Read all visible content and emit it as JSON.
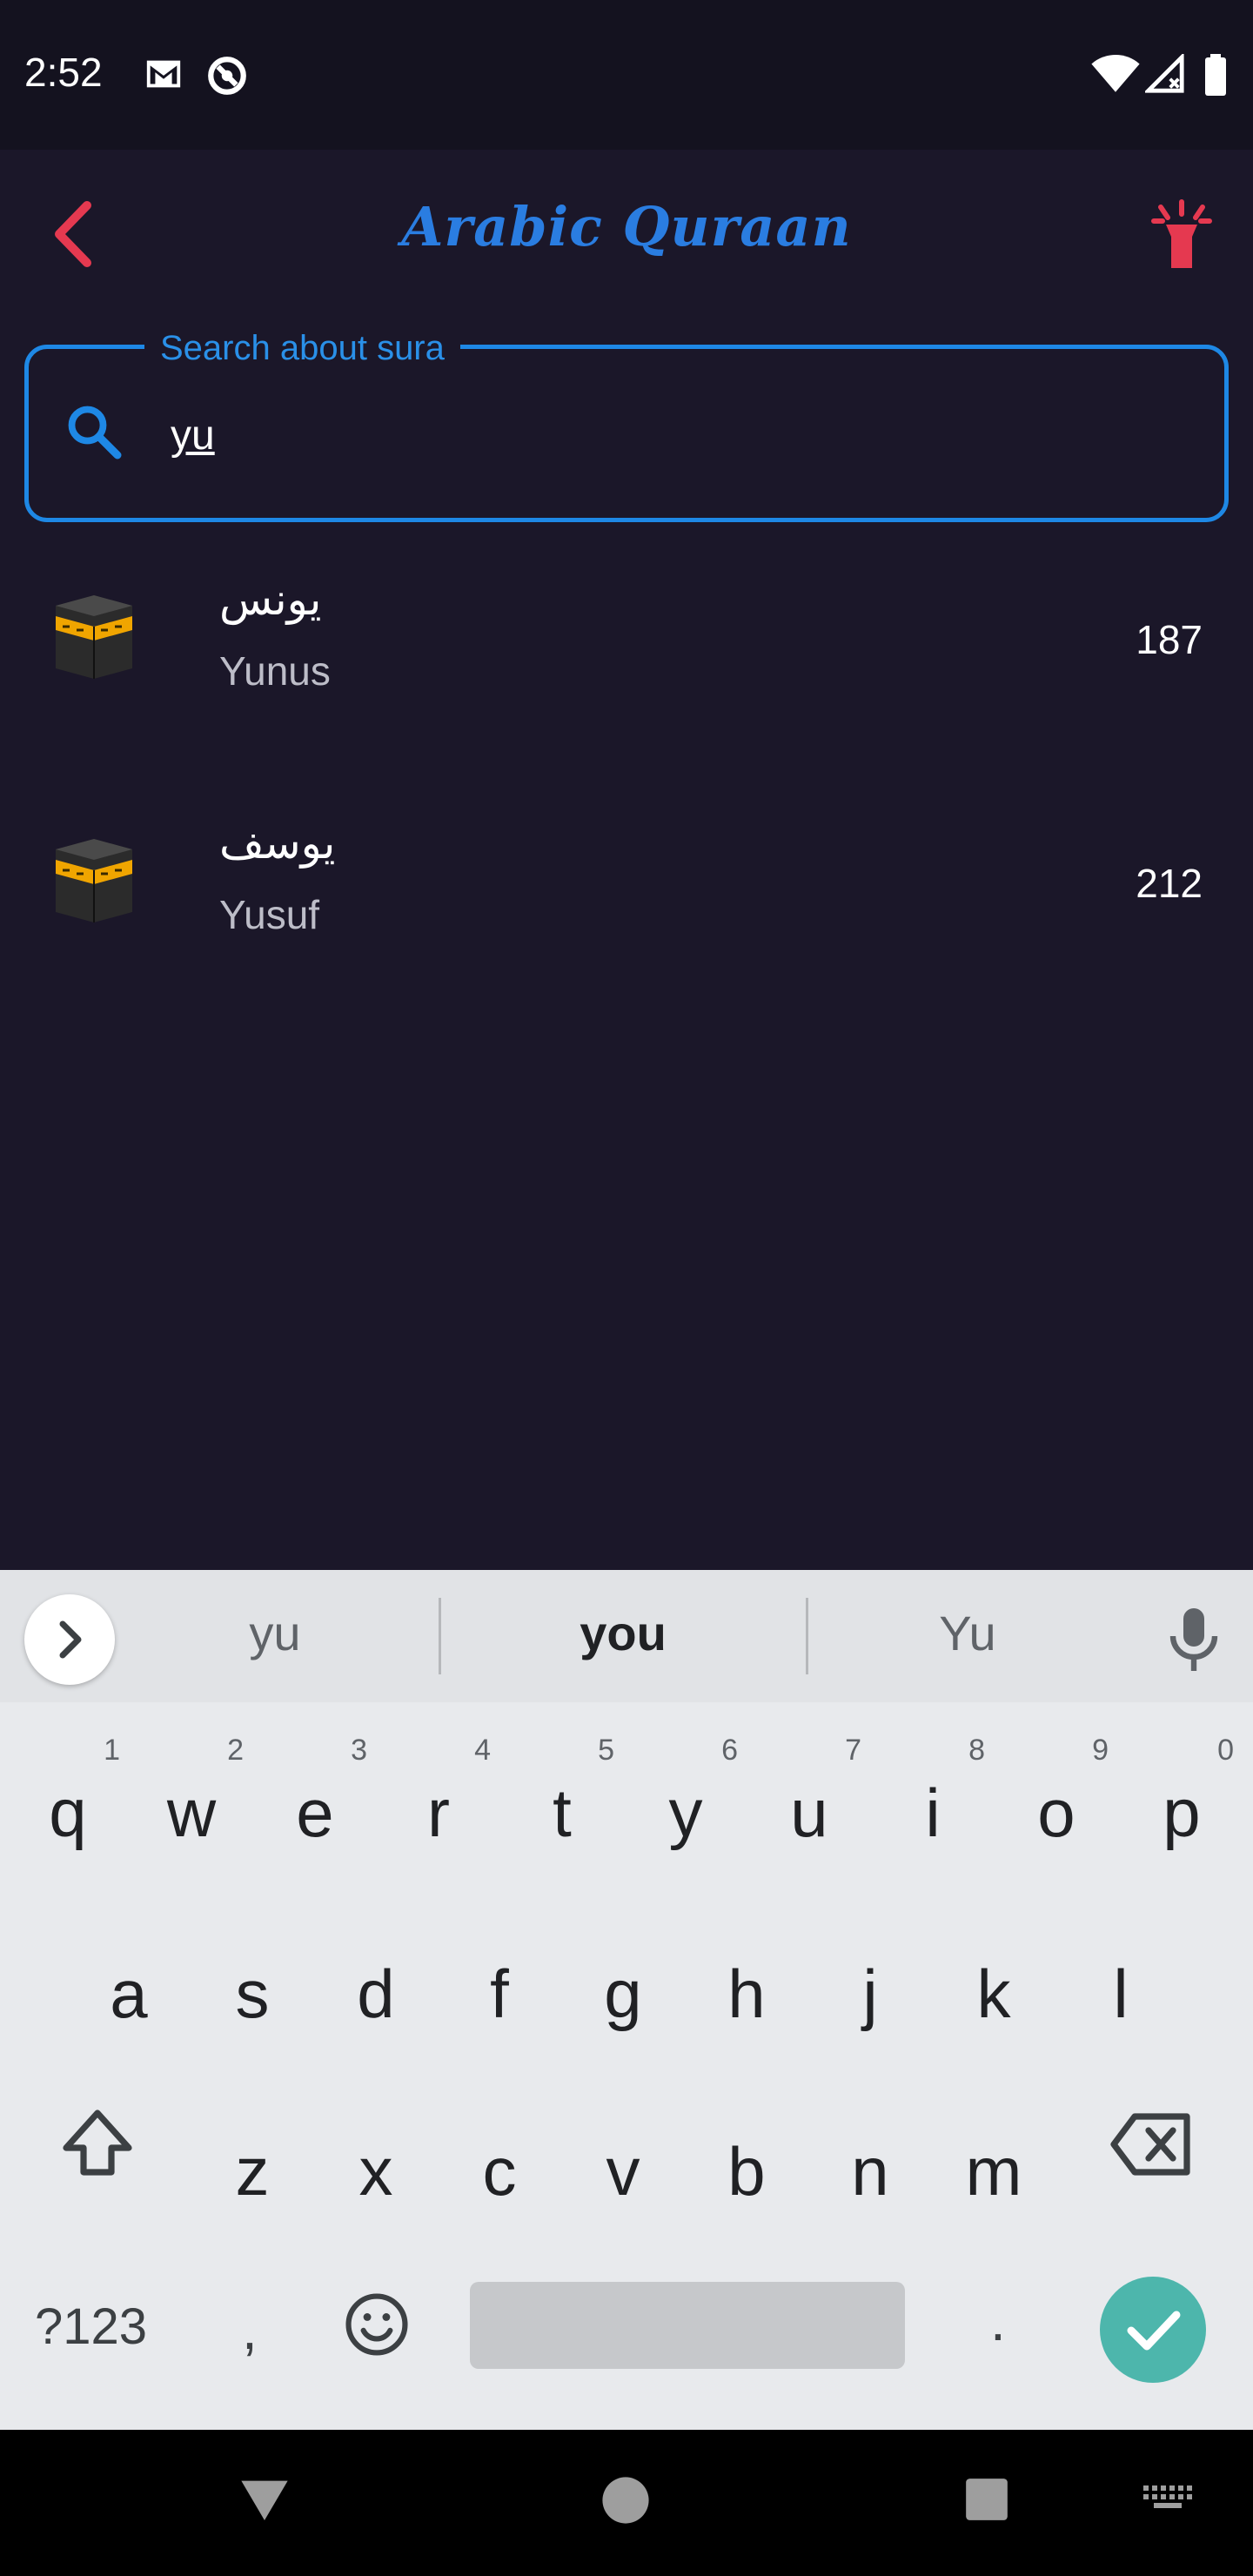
{
  "status_bar": {
    "time": "2:52",
    "left_icons": [
      "gmail-icon",
      "do-not-disturb-icon"
    ],
    "right_icons": [
      "wifi-icon",
      "signal-icon",
      "battery-icon"
    ]
  },
  "app_bar": {
    "title": "Arabic Quraan",
    "back_icon": "chevron-left-icon",
    "right_icon": "flashlight-icon",
    "accent_color": "#e53950",
    "title_color": "#2a7de1"
  },
  "search": {
    "label": "Search about sura",
    "value": "yu",
    "icon": "search-icon",
    "border_color": "#1e88e5"
  },
  "results": [
    {
      "arabic": "يونس",
      "name": "Yunus",
      "count": "187",
      "icon": "kaaba-icon"
    },
    {
      "arabic": "يوسف",
      "name": "Yusuf",
      "count": "212",
      "icon": "kaaba-icon"
    }
  ],
  "keyboard": {
    "suggestions": [
      "yu",
      "you",
      "Yu"
    ],
    "row1": [
      {
        "ch": "q",
        "hint": "1"
      },
      {
        "ch": "w",
        "hint": "2"
      },
      {
        "ch": "e",
        "hint": "3"
      },
      {
        "ch": "r",
        "hint": "4"
      },
      {
        "ch": "t",
        "hint": "5"
      },
      {
        "ch": "y",
        "hint": "6"
      },
      {
        "ch": "u",
        "hint": "7"
      },
      {
        "ch": "i",
        "hint": "8"
      },
      {
        "ch": "o",
        "hint": "9"
      },
      {
        "ch": "p",
        "hint": "0"
      }
    ],
    "row2": [
      "a",
      "s",
      "d",
      "f",
      "g",
      "h",
      "j",
      "k",
      "l"
    ],
    "row3": [
      "z",
      "x",
      "c",
      "v",
      "b",
      "n",
      "m"
    ],
    "symbols_label": "?123",
    "comma": ",",
    "period": ".",
    "enter_color": "#4db6ac"
  },
  "nav_bar": {
    "icons": [
      "back-triangle-icon",
      "home-circle-icon",
      "recents-square-icon",
      "keyboard-switch-icon"
    ]
  }
}
